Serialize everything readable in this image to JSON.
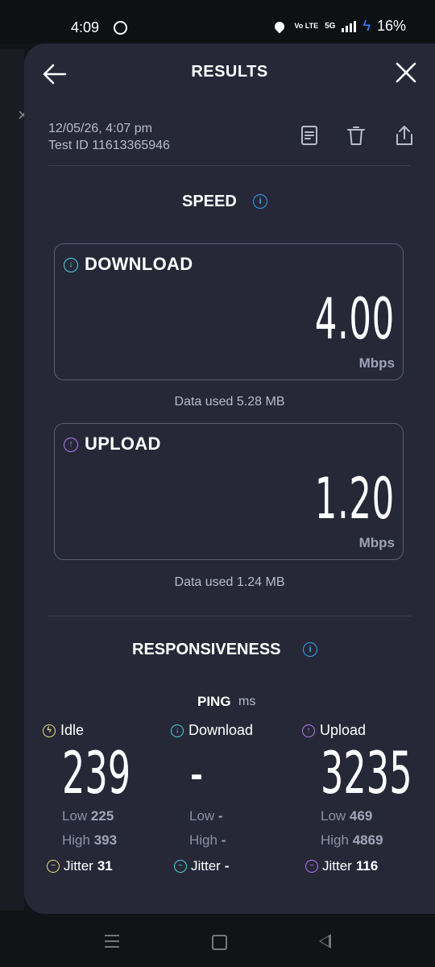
{
  "status_bar": {
    "time": "4:09",
    "volte": "Vo LTE",
    "network": "5G",
    "battery": "16%"
  },
  "header": {
    "title": "RESULTS"
  },
  "meta": {
    "date": "12/05/26, 4:07 pm",
    "test_id": "Test ID 11613365946"
  },
  "speed": {
    "title": "SPEED",
    "download": {
      "label": "DOWNLOAD",
      "value": "4.00",
      "unit": "Mbps",
      "data_used": "Data used 5.28 MB"
    },
    "upload": {
      "label": "UPLOAD",
      "value": "1.20",
      "unit": "Mbps",
      "data_used": "Data used 1.24 MB"
    }
  },
  "responsiveness": {
    "title": "RESPONSIVENESS",
    "ping_label": "PING",
    "ping_unit": "ms",
    "columns": [
      {
        "label": "Idle",
        "value": "239",
        "low_label": "Low",
        "low": "225",
        "high_label": "High",
        "high": "393",
        "jitter_label": "Jitter",
        "jitter": "31"
      },
      {
        "label": "Download",
        "value": "-",
        "low_label": "Low",
        "low": "-",
        "high_label": "High",
        "high": "-",
        "jitter_label": "Jitter",
        "jitter": "-"
      },
      {
        "label": "Upload",
        "value": "3235",
        "low_label": "Low",
        "low": "469",
        "high_label": "High",
        "high": "4869",
        "jitter_label": "Jitter",
        "jitter": "116"
      }
    ]
  },
  "colors": {
    "background": "#262838",
    "download_accent": "#4fd8e0",
    "upload_accent": "#b57cf0",
    "idle_accent": "#f0e07a",
    "info": "#2fa6ee"
  }
}
